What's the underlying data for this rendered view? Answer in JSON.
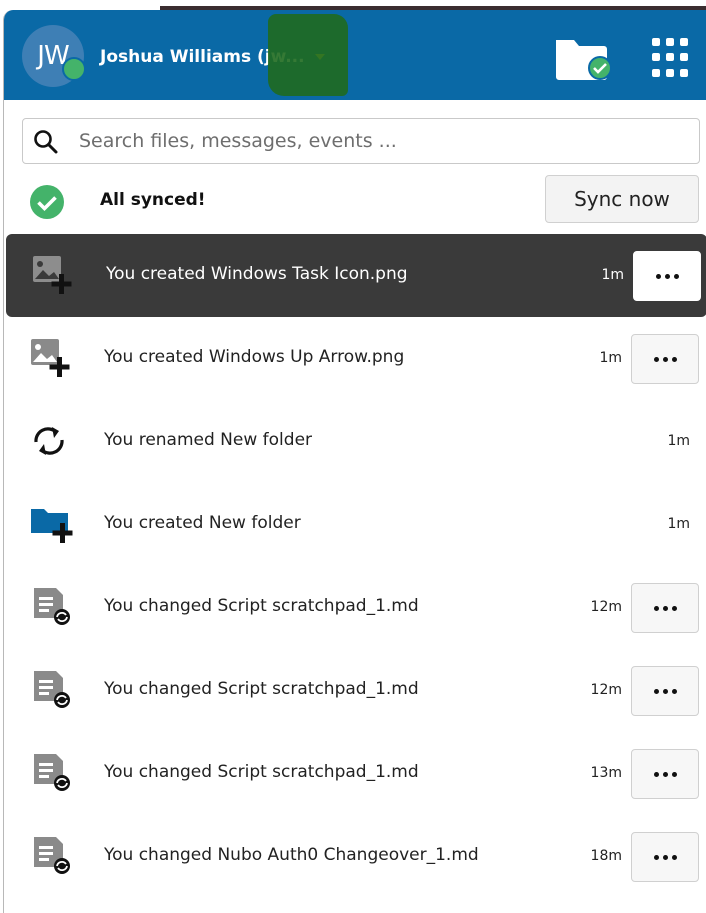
{
  "header": {
    "avatar_initials": "JW",
    "user_name": "Joshua Williams (jw...",
    "colors": {
      "bar": "#0a69a6",
      "status_online": "#44b36a"
    },
    "folder_button_icon": "folder-synced-icon",
    "apps_button_icon": "apps-grid-icon"
  },
  "search": {
    "placeholder": "Search files, messages, events ...",
    "value": ""
  },
  "sync": {
    "status_text": "All synced!",
    "button_label": "Sync now",
    "status_icon": "check-circle-icon"
  },
  "activities": [
    {
      "icon": "image-add-icon",
      "text": "You created Windows Task Icon.png",
      "time": "1m",
      "has_menu": true,
      "selected": true
    },
    {
      "icon": "image-add-icon",
      "text": "You created Windows Up Arrow.png",
      "time": "1m",
      "has_menu": true,
      "selected": false
    },
    {
      "icon": "rename-sync-icon",
      "text": "You renamed New folder",
      "time": "1m",
      "has_menu": false,
      "selected": false
    },
    {
      "icon": "folder-add-icon",
      "text": "You created New folder",
      "time": "1m",
      "has_menu": false,
      "selected": false
    },
    {
      "icon": "file-changed-icon",
      "text": "You changed Script scratchpad_1.md",
      "time": "12m",
      "has_menu": true,
      "selected": false
    },
    {
      "icon": "file-changed-icon",
      "text": "You changed Script scratchpad_1.md",
      "time": "12m",
      "has_menu": true,
      "selected": false
    },
    {
      "icon": "file-changed-icon",
      "text": "You changed Script scratchpad_1.md",
      "time": "13m",
      "has_menu": true,
      "selected": false
    },
    {
      "icon": "file-changed-icon",
      "text": "You changed Nubo Auth0 Changeover_1.md",
      "time": "18m",
      "has_menu": true,
      "selected": false
    }
  ]
}
